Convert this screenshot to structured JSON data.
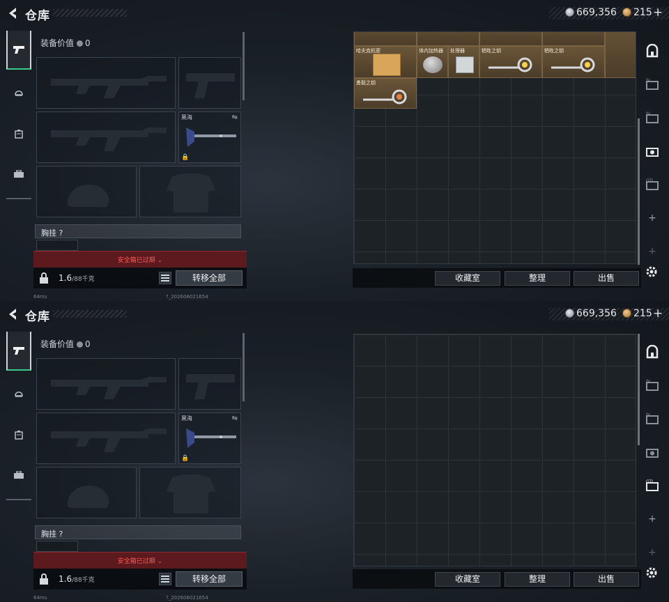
{
  "panels": [
    {
      "header": {
        "title": "仓库",
        "money": "669,356",
        "coupon": "215",
        "plus": "+"
      },
      "equipment": {
        "value_label": "装备价值",
        "value": "0",
        "melee_label": "黑海",
        "chest_label": "胸挂",
        "chest_help": "?"
      },
      "expired_text": "安全箱已过期",
      "weight": {
        "current": "1.6",
        "max": "/88千克"
      },
      "transfer_label": "转移全部",
      "store_buttons": [
        "收藏室",
        "整理",
        "出售"
      ],
      "storage_items": [
        {
          "label": ""
        },
        {
          "label": ""
        },
        {
          "label": ""
        },
        {
          "label": ""
        },
        {
          "label": ""
        },
        {
          "label": "哈夫克机密"
        },
        {
          "label": "体内加热器"
        },
        {
          "label": "处理器"
        },
        {
          "label": "牺牲之钥"
        },
        {
          "label": "牺牲之钥"
        },
        {
          "label": ""
        },
        {
          "label": "勇毅之钥"
        }
      ],
      "right_tabs_plus": [
        "+",
        "+"
      ],
      "status": {
        "ping": "64ms",
        "version": "?_202606021654"
      }
    },
    {
      "header": {
        "title": "仓库",
        "money": "669,356",
        "coupon": "215",
        "plus": "+"
      },
      "equipment": {
        "value_label": "装备价值",
        "value": "0",
        "melee_label": "黑海",
        "chest_label": "胸挂",
        "chest_help": "?"
      },
      "expired_text": "安全箱已过期",
      "weight": {
        "current": "1.6",
        "max": "/88千克"
      },
      "transfer_label": "转移全部",
      "store_buttons": [
        "收藏室",
        "整理",
        "出售"
      ],
      "right_tabs_plus": [
        "+",
        "+"
      ],
      "status": {
        "ping": "64ms",
        "version": "?_202606021654"
      }
    }
  ],
  "colors": {
    "accent_green": "#38c98c",
    "warning_red": "#ff5a55",
    "expired_bg": "#5c1a1e",
    "item_tan": "#6a5538"
  },
  "icons": {
    "back": "chevron-left-icon",
    "money": "silver-coin-icon",
    "coupon": "gold-coin-icon",
    "left_tabs": [
      "pistol-icon",
      "helmet-icon",
      "backpack-icon",
      "toolbox-icon"
    ],
    "right_tabs": [
      "safe-icon",
      "tv-case-icon",
      "tv-case-icon",
      "camera-case-icon",
      "gti-case-icon"
    ],
    "settings": "gear-icon",
    "lock": "lock-icon",
    "list": "list-icon",
    "swap": "swap-icon"
  }
}
